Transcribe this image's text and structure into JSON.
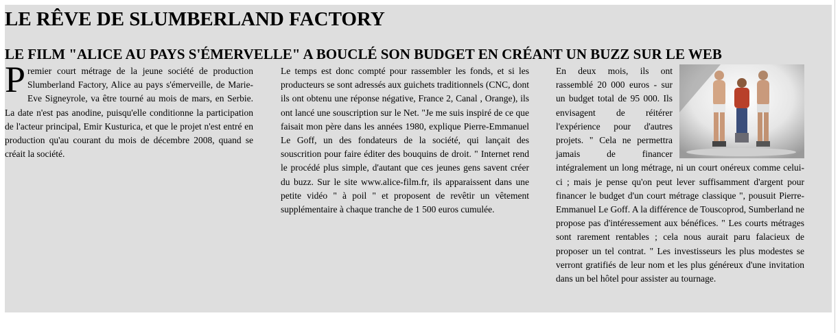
{
  "article": {
    "title": "LE RÊVE DE SLUMBERLAND FACTORY",
    "subtitle": "LE FILM \"ALICE AU PAYS S'ÉMERVELLE\" A BOUCLÉ SON BUDGET EN CRÉANT UN BUZZ SUR LE WEB",
    "col1": {
      "dropcap": "P",
      "text": "remier court métrage de la jeune société de production Slumberland Factory, Alice au pays s'émerveille, de Marie-Eve Signeyrole, va être tourné au mois de mars, en Serbie. La date n'est pas anodine, puisqu'elle conditionne la participation de l'acteur principal, Emir Kusturica, et que le projet n'est entré en production qu'au courant du mois de décembre 2008, quand se créait la société."
    },
    "col2": {
      "text": "Le temps est donc compté pour rassembler les fonds, et si les producteurs se sont adressés aux guichets traditionnels (CNC, dont ils ont obtenu une réponse négative, France 2, Canal , Orange), ils ont lancé une souscription sur le Net. \"Je me suis inspiré de ce que faisait mon père dans les années 1980, explique Pierre-Emmanuel Le Goff, un des fondateurs de la société, qui lançait des souscrition pour faire éditer des bouquins de droit. \" Internet rend le procédé plus simple, d'autant que ces jeunes gens savent créer du buzz. Sur le site www.alice-film.fr, ils apparaissent dans une petite vidéo \" à poil \" et proposent de revêtir un vêtement supplémentaire à chaque tranche de 1 500 euros cumulée."
    },
    "col3": {
      "text": "En deux mois, ils ont rassemblé 20 000 euros - sur un budget total de 95 000. Ils envisagent de réitérer l'expérience pour d'autres projets. \" Cela ne permettra jamais de financer intégralement un long métrage, ni un court onéreux comme celui-ci ; mais je pense qu'on peut lever suffisamment d'argent pour financer le budget d'un court métrage classique \", pousuit Pierre-Emmanuel Le Goff. A la différence de Touscoprod, Sumberland ne propose pas d'intéressement aux bénéfices. \" Les courts métrages sont rarement rentables ; cela nous aurait paru falacieux de proposer un tel contrat. \" Les investisseurs les plus modestes se verront gratifiés de leur nom et les plus généreux d'une invitation dans un bel hôtel pour assister au tournage."
    }
  },
  "colors": {
    "article_background": "#dedede",
    "text": "#000000"
  }
}
